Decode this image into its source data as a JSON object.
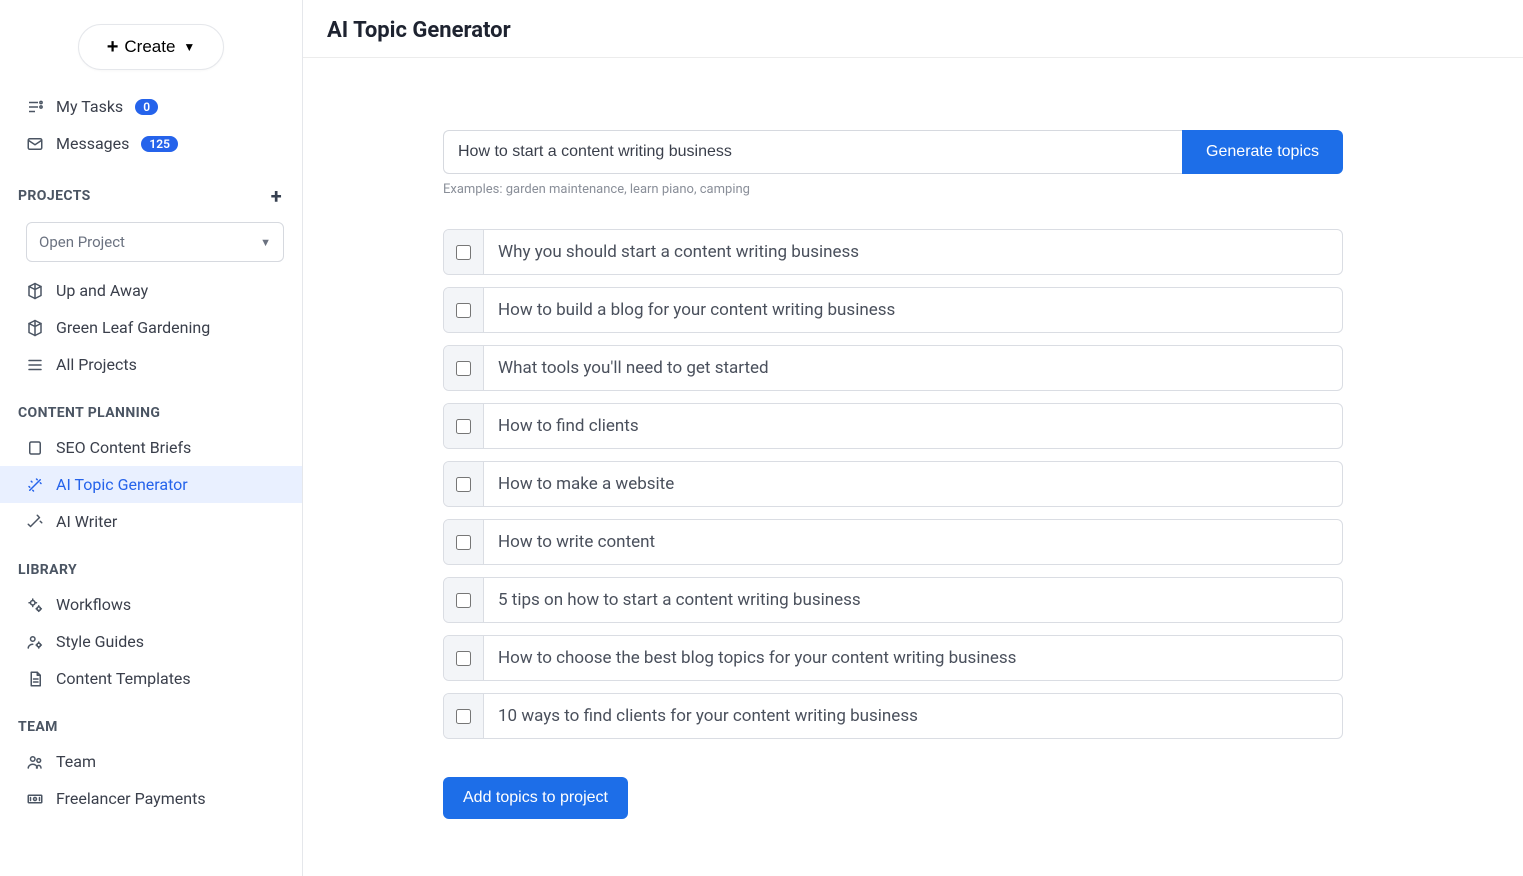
{
  "header": {
    "create_label": "Create"
  },
  "nav": {
    "my_tasks": {
      "label": "My Tasks",
      "badge": "0"
    },
    "messages": {
      "label": "Messages",
      "badge": "125"
    }
  },
  "projects": {
    "header": "PROJECTS",
    "select_label": "Open Project",
    "items": [
      {
        "label": "Up and Away",
        "icon": "cube"
      },
      {
        "label": "Green Leaf Gardening",
        "icon": "cube"
      },
      {
        "label": "All Projects",
        "icon": "menu"
      }
    ]
  },
  "content_planning": {
    "header": "CONTENT PLANNING",
    "items": [
      {
        "label": "SEO Content Briefs",
        "icon": "note",
        "active": false
      },
      {
        "label": "AI Topic Generator",
        "icon": "wand",
        "active": true
      },
      {
        "label": "AI Writer",
        "icon": "magic",
        "active": false
      }
    ]
  },
  "library": {
    "header": "LIBRARY",
    "items": [
      {
        "label": "Workflows",
        "icon": "gears"
      },
      {
        "label": "Style Guides",
        "icon": "person-gear"
      },
      {
        "label": "Content Templates",
        "icon": "file"
      }
    ]
  },
  "team": {
    "header": "TEAM",
    "items": [
      {
        "label": "Team",
        "icon": "people"
      },
      {
        "label": "Freelancer Payments",
        "icon": "cash"
      }
    ]
  },
  "page": {
    "title": "AI Topic Generator",
    "input_value": "How to start a content writing business",
    "generate_label": "Generate topics",
    "examples": "Examples: garden maintenance, learn piano, camping",
    "topics": [
      "Why you should start a content writing business",
      "How to build a blog for your content writing business",
      "What tools you'll need to get started",
      "How to find clients",
      "How to make a website",
      "How to write content",
      "5 tips on how to start a content writing business",
      "How to choose the best blog topics for your content writing business",
      "10 ways to find clients for your content writing business"
    ],
    "add_label": "Add topics to project"
  }
}
